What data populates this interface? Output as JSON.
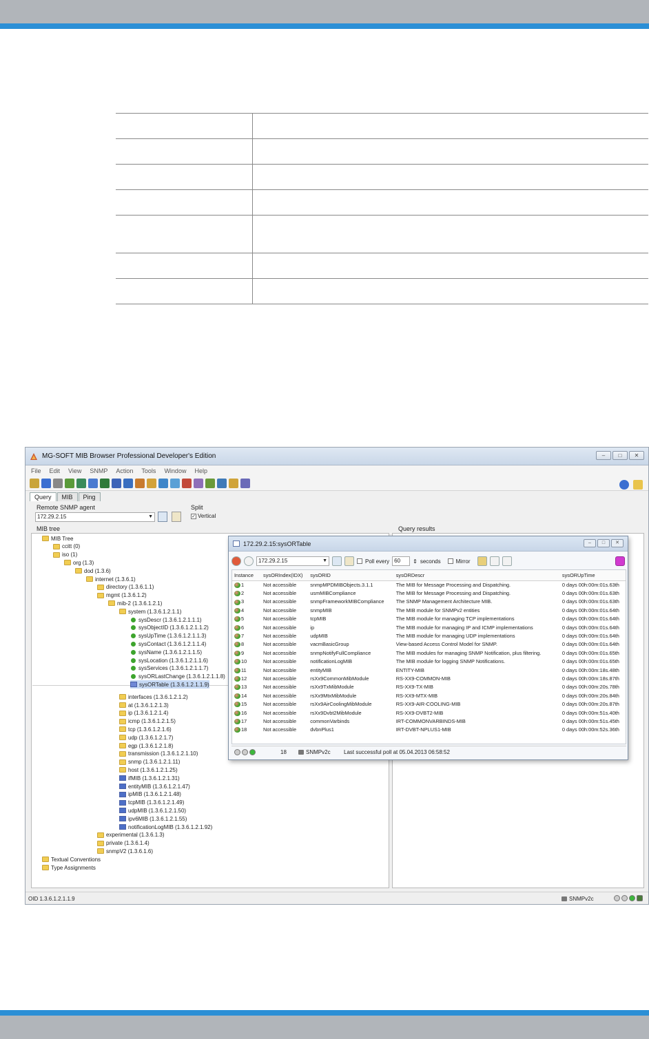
{
  "colors": {
    "accent_rule": "#2b8fd6",
    "band": "#b1b5ba"
  },
  "doc_table_rows": [
    {
      "c1": "",
      "c2": "",
      "tall": false
    },
    {
      "c1": "",
      "c2": "",
      "tall": false
    },
    {
      "c1": "",
      "c2": "",
      "tall": false
    },
    {
      "c1": "",
      "c2": "",
      "tall": false
    },
    {
      "c1": "",
      "c2": "",
      "tall": true
    },
    {
      "c1": "",
      "c2": "",
      "tall": false
    },
    {
      "c1": "",
      "c2": "",
      "tall": false
    }
  ],
  "app": {
    "title": "MG-SOFT MIB Browser Professional Developer's Edition",
    "menu": [
      "File",
      "Edit",
      "View",
      "SNMP",
      "Action",
      "Tools",
      "Window",
      "Help"
    ],
    "toolbar_icons": [
      "connect-icon",
      "query-icon",
      "walk-icon",
      "trap-icon",
      "table-icon",
      "refresh-icon",
      "globe-icon",
      "info-icon",
      "list-icon",
      "chart-icon",
      "search-icon",
      "ping-icon",
      "settings-icon",
      "graph-icon",
      "compile-icon",
      "key-icon",
      "help-icon",
      "export-icon",
      "print-icon"
    ],
    "tabs": [
      "Query",
      "MIB",
      "Ping"
    ],
    "remote_agent_label": "Remote SNMP agent",
    "remote_agent_value": "172.29.2.15",
    "split_label": "Split",
    "vertical_label": "Vertical",
    "vertical_checked": "✓",
    "mib_tree_label": "MIB tree",
    "query_results_label": "Query results",
    "status_oid": "OID 1.3.6.1.2.1.1.9",
    "status_version": "SNMPv2c"
  },
  "tree": [
    {
      "label": "MIB Tree",
      "icon": "folder",
      "depth": 0
    },
    {
      "label": "ccitt (0)",
      "icon": "folder",
      "depth": 1
    },
    {
      "label": "iso (1)",
      "icon": "folder",
      "depth": 1
    },
    {
      "label": "org (1.3)",
      "icon": "folder",
      "depth": 2
    },
    {
      "label": "dod (1.3.6)",
      "icon": "folder",
      "depth": 3
    },
    {
      "label": "internet (1.3.6.1)",
      "icon": "folder",
      "depth": 4
    },
    {
      "label": "directory (1.3.6.1.1)",
      "icon": "folder",
      "depth": 5
    },
    {
      "label": "mgmt (1.3.6.1.2)",
      "icon": "folder",
      "depth": 5
    },
    {
      "label": "mib-2 (1.3.6.1.2.1)",
      "icon": "folder",
      "depth": 6
    },
    {
      "label": "system (1.3.6.1.2.1.1)",
      "icon": "folder",
      "depth": 7
    },
    {
      "label": "sysDescr (1.3.6.1.2.1.1.1)",
      "icon": "leaf",
      "depth": 8
    },
    {
      "label": "sysObjectID (1.3.6.1.2.1.1.2)",
      "icon": "leaf",
      "depth": 8
    },
    {
      "label": "sysUpTime (1.3.6.1.2.1.1.3)",
      "icon": "leaf",
      "depth": 8
    },
    {
      "label": "sysContact (1.3.6.1.2.1.1.4)",
      "icon": "leaf",
      "depth": 8
    },
    {
      "label": "sysName (1.3.6.1.2.1.1.5)",
      "icon": "leaf",
      "depth": 8
    },
    {
      "label": "sysLocation (1.3.6.1.2.1.1.6)",
      "icon": "leaf",
      "depth": 8
    },
    {
      "label": "sysServices (1.3.6.1.2.1.1.7)",
      "icon": "leaf",
      "depth": 8
    },
    {
      "label": "sysORLastChange (1.3.6.1.2.1.1.8)",
      "icon": "leaf",
      "depth": 8
    },
    {
      "label": "sysORTable (1.3.6.1.2.1.1.9)",
      "icon": "table",
      "depth": 8,
      "selected": true
    },
    {
      "label": "interfaces (1.3.6.1.2.1.2)",
      "icon": "folder",
      "depth": 7
    },
    {
      "label": "at (1.3.6.1.2.1.3)",
      "icon": "folder",
      "depth": 7
    },
    {
      "label": "ip (1.3.6.1.2.1.4)",
      "icon": "folder",
      "depth": 7
    },
    {
      "label": "icmp (1.3.6.1.2.1.5)",
      "icon": "folder",
      "depth": 7
    },
    {
      "label": "tcp (1.3.6.1.2.1.6)",
      "icon": "folder",
      "depth": 7
    },
    {
      "label": "udp (1.3.6.1.2.1.7)",
      "icon": "folder",
      "depth": 7
    },
    {
      "label": "egp (1.3.6.1.2.1.8)",
      "icon": "folder",
      "depth": 7
    },
    {
      "label": "transmission (1.3.6.1.2.1.10)",
      "icon": "folder",
      "depth": 7
    },
    {
      "label": "snmp (1.3.6.1.2.1.11)",
      "icon": "folder",
      "depth": 7
    },
    {
      "label": "host (1.3.6.1.2.1.25)",
      "icon": "folder",
      "depth": 7
    },
    {
      "label": "ifMIB (1.3.6.1.2.1.31)",
      "icon": "mib",
      "depth": 7
    },
    {
      "label": "entityMIB (1.3.6.1.2.1.47)",
      "icon": "mib",
      "depth": 7
    },
    {
      "label": "ipMIB (1.3.6.1.2.1.48)",
      "icon": "mib",
      "depth": 7
    },
    {
      "label": "tcpMIB (1.3.6.1.2.1.49)",
      "icon": "mib",
      "depth": 7
    },
    {
      "label": "udpMIB (1.3.6.1.2.1.50)",
      "icon": "mib",
      "depth": 7
    },
    {
      "label": "ipv6MIB (1.3.6.1.2.1.55)",
      "icon": "mib",
      "depth": 7
    },
    {
      "label": "notificationLogMIB (1.3.6.1.2.1.92)",
      "icon": "mib",
      "depth": 7
    },
    {
      "label": "experimental (1.3.6.1.3)",
      "icon": "folder",
      "depth": 5
    },
    {
      "label": "private (1.3.6.1.4)",
      "icon": "folder",
      "depth": 5
    },
    {
      "label": "snmpV2 (1.3.6.1.6)",
      "icon": "folder",
      "depth": 5
    },
    {
      "label": "Textual Conventions",
      "icon": "folder",
      "depth": 0
    },
    {
      "label": "Type Assignments",
      "icon": "folder",
      "depth": 0
    }
  ],
  "result_window": {
    "title": "172.29.2.15:sysORTable",
    "agent": "172.29.2.15",
    "poll_label": "Poll every",
    "poll_value": "60",
    "seconds_label": "seconds",
    "mirror_label": "Mirror",
    "columns": [
      "Instance",
      "sysORIndex(IDX)",
      "sysORID",
      "sysORDescr",
      "sysORUpTime"
    ],
    "rows": [
      [
        "1",
        "Not accessible",
        "snmpMPDMIBObjects.3.1.1",
        "The MIB for Message Processing and Dispatching.",
        "0 days 00h:00m:01s.63th"
      ],
      [
        "2",
        "Not accessible",
        "usmMIBCompliance",
        "The MIB for Message Processing and Dispatching.",
        "0 days 00h:00m:01s.63th"
      ],
      [
        "3",
        "Not accessible",
        "snmpFrameworkMIBCompliance",
        "The SNMP Management Architecture MIB.",
        "0 days 00h:00m:01s.63th"
      ],
      [
        "4",
        "Not accessible",
        "snmpMIB",
        "The MIB module for SNMPv2 entities",
        "0 days 00h:00m:01s.64th"
      ],
      [
        "5",
        "Not accessible",
        "tcpMIB",
        "The MIB module for managing TCP implementations",
        "0 days 00h:00m:01s.64th"
      ],
      [
        "6",
        "Not accessible",
        "ip",
        "The MIB module for managing IP and ICMP implementations",
        "0 days 00h:00m:01s.64th"
      ],
      [
        "7",
        "Not accessible",
        "udpMIB",
        "The MIB module for managing UDP implementations",
        "0 days 00h:00m:01s.64th"
      ],
      [
        "8",
        "Not accessible",
        "vacmBasicGroup",
        "View-based Access Control Model for SNMP.",
        "0 days 00h:00m:01s.64th"
      ],
      [
        "9",
        "Not accessible",
        "snmpNotifyFullCompliance",
        "The MIB modules for managing SNMP Notification, plus filtering.",
        "0 days 00h:00m:01s.65th"
      ],
      [
        "10",
        "Not accessible",
        "notificationLogMIB",
        "The MIB module for logging SNMP Notifications.",
        "0 days 00h:00m:01s.65th"
      ],
      [
        "11",
        "Not accessible",
        "entityMIB",
        "ENTITY-MIB",
        "0 days 00h:00m:18s.48th"
      ],
      [
        "12",
        "Not accessible",
        "rsXx9CommonMibModule",
        "RS-XX9-COMMON-MIB",
        "0 days 00h:00m:18s.87th"
      ],
      [
        "13",
        "Not accessible",
        "rsXx9TxMibModule",
        "RS-XX9-TX-MIB",
        "0 days 00h:00m:20s.78th"
      ],
      [
        "14",
        "Not accessible",
        "rsXx9MtxMibModule",
        "RS-XX9-MTX-MIB",
        "0 days 00h:00m:20s.84th"
      ],
      [
        "15",
        "Not accessible",
        "rsXx9AirCoolingMibModule",
        "RS-XX9-AIR-COOLING-MIB",
        "0 days 00h:00m:20s.87th"
      ],
      [
        "16",
        "Not accessible",
        "rsXx9Dvbt2MibModule",
        "RS-XX9-DVBT2-MIB",
        "0 days 00h:00m:51s.40th"
      ],
      [
        "17",
        "Not accessible",
        "commonVarbinds",
        "IRT-COMMONVARBINDS-MIB",
        "0 days 00h:00m:51s.45th"
      ],
      [
        "18",
        "Not accessible",
        "dvbnPlus1",
        "IRT-DVBT-NPLUS1-MIB",
        "0 days 00h:00m:52s.36th"
      ]
    ],
    "status_count": "18",
    "status_version": "SNMPv2c",
    "status_poll": "Last successful poll at 05.04.2013 06:58:52"
  }
}
